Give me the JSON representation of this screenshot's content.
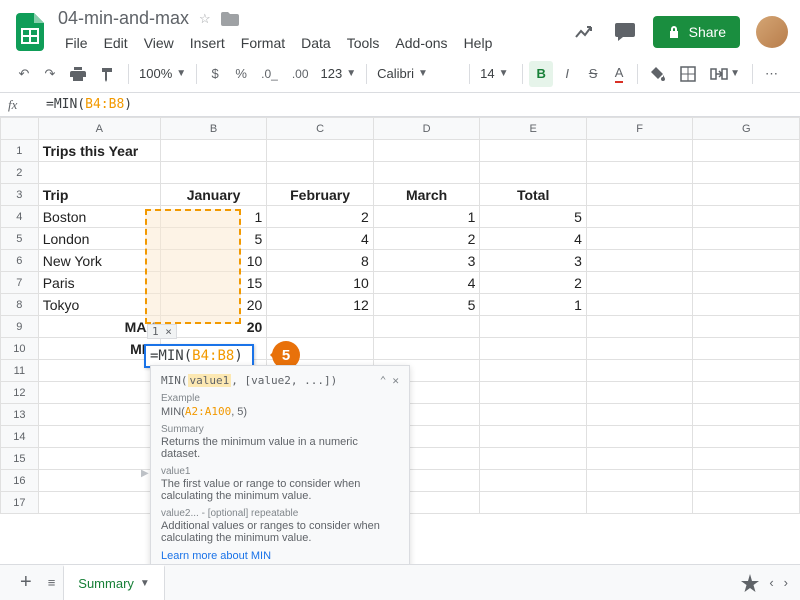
{
  "doc_title": "04-min-and-max",
  "menubar": [
    "File",
    "Edit",
    "View",
    "Insert",
    "Format",
    "Data",
    "Tools",
    "Add-ons",
    "Help"
  ],
  "share_label": "Share",
  "toolbar": {
    "zoom": "100%",
    "number_fmt": "123",
    "font": "Calibri",
    "font_size": "14"
  },
  "formula_bar": {
    "prefix": "=MIN(",
    "range": "B4:B8",
    "suffix": ")"
  },
  "columns": [
    "A",
    "B",
    "C",
    "D",
    "E",
    "F",
    "G"
  ],
  "rows_count": 17,
  "cells": {
    "A1": "Trips this Year",
    "A3": "Trip",
    "B3": "January",
    "C3": "February",
    "D3": "March",
    "E3": "Total",
    "A4": "Boston",
    "B4": "1",
    "C4": "2",
    "D4": "1",
    "E4": "5",
    "A5": "London",
    "B5": "5",
    "C5": "4",
    "D5": "2",
    "E5": "4",
    "A6": "New York",
    "B6": "10",
    "C6": "8",
    "D6": "3",
    "E6": "3",
    "A7": "Paris",
    "B7": "15",
    "C7": "10",
    "D7": "4",
    "E7": "2",
    "A8": "Tokyo",
    "B8": "20",
    "C8": "12",
    "D8": "5",
    "E8": "1",
    "A9": "MAX",
    "B9": "20",
    "A10": "MIN"
  },
  "result_chip": "1 ×",
  "editing": {
    "prefix": "=MIN(",
    "range": "B4:B8",
    "suffix": ")"
  },
  "callout": "5",
  "tooltip": {
    "sig_fn": "MIN(",
    "sig_arg1": "value1",
    "sig_rest": ", [value2, ...])",
    "example_label": "Example",
    "example_pre": "MIN(",
    "example_range": "A2:A100",
    "example_post": ", 5)",
    "summary_label": "Summary",
    "summary_text": "Returns the minimum value in a numeric dataset.",
    "arg1_label": "value1",
    "arg1_text": "The first value or range to consider when calculating the minimum value.",
    "arg2_label": "value2... - [optional] repeatable",
    "arg2_text": "Additional values or ranges to consider when calculating the minimum value.",
    "learn_more": "Learn more about MIN"
  },
  "sheet_tab": "Summary"
}
